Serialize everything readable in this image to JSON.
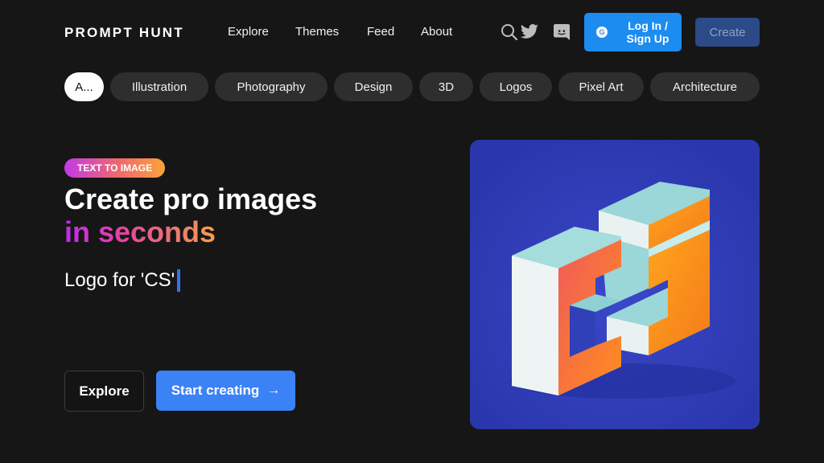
{
  "brand": {
    "name": "PROMPT HUNT"
  },
  "nav": {
    "links": [
      "Explore",
      "Themes",
      "Feed",
      "About"
    ],
    "icons": [
      "search-icon",
      "twitter-icon",
      "discord-icon"
    ],
    "login": {
      "icon": "google-icon",
      "label": "Log In / Sign Up"
    },
    "create_label": "Create"
  },
  "categories": {
    "items": [
      "A...",
      "Illustration",
      "Photography",
      "Design",
      "3D",
      "Logos",
      "Pixel Art",
      "Architecture"
    ],
    "active_index": 0
  },
  "hero": {
    "badge": "TEXT TO IMAGE",
    "headline_line1": "Create pro images",
    "headline_line2": "in seconds",
    "prompt_text": "Logo for 'CS'",
    "explore_label": "Explore",
    "start_label": "Start creating",
    "start_icon": "arrow-right-icon"
  },
  "colors": {
    "background": "#161616",
    "accent_blue": "#3b82f6",
    "login_blue": "#1c8cf0",
    "create_button": "#2b4a87",
    "pill": "#2e2e2e",
    "card_background": "#2d3bb4",
    "gradient": [
      "#c229ee",
      "#e2469f",
      "#f7a04a"
    ]
  }
}
